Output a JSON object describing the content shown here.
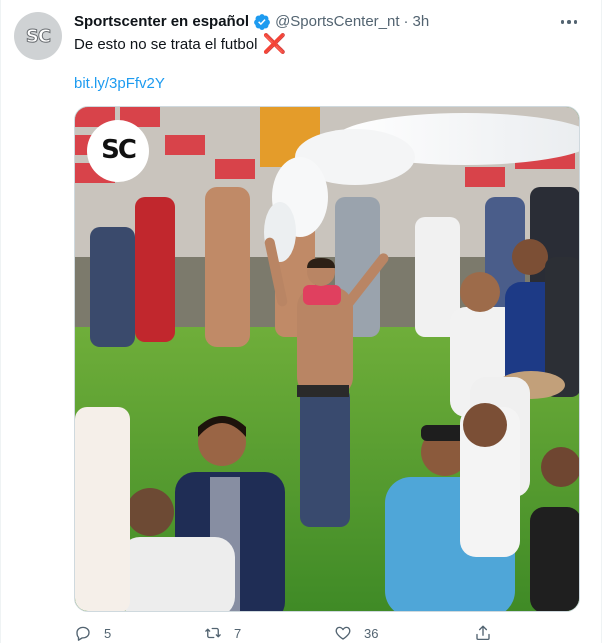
{
  "account": {
    "display_name": "Sportscenter en español",
    "handle": "@SportsCenter_nt",
    "separator": "·",
    "time": "3h",
    "avatar_logo": "SC"
  },
  "tweet": {
    "text": "De esto no se trata el futbol",
    "emoji": "❌",
    "link": "bit.ly/3pFfv2Y"
  },
  "media": {
    "overlay_logo": "SC"
  },
  "actions": {
    "reply_count": "5",
    "retweet_count": "7",
    "like_count": "36"
  },
  "colors": {
    "link": "#1d9bf0",
    "verified": "#1d9bf0",
    "muted": "#536471",
    "x_mark": "#dd2e44"
  }
}
